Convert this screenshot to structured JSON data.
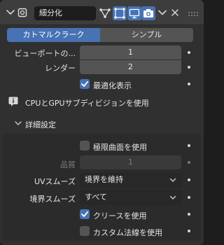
{
  "modifier": {
    "name": "細分化",
    "icons": {
      "collapse": "chevron-down-icon",
      "modifier_type": "subdivision-modifier-icon",
      "on_cage": "vertex-triangle-icon",
      "edit_mode": "edit-mode-icon",
      "realtime": "monitor-icon",
      "render": "camera-icon",
      "menu": "chevron-down-icon",
      "delete": "close-icon",
      "drag": "drag-grip-icon"
    }
  },
  "tabs": [
    {
      "label": "カトマルクラーク",
      "active": true
    },
    {
      "label": "シンプル",
      "active": false
    }
  ],
  "levels": {
    "viewport_label": "ビューポートの...",
    "viewport_value": "1",
    "render_label": "レンダー",
    "render_value": "2"
  },
  "optimal_display": {
    "label": "最適化表示",
    "checked": true
  },
  "gpu_notice": {
    "icon": "info-icon",
    "text": "CPUとGPUサブディビジョンを使用"
  },
  "advanced": {
    "title": "詳細設定",
    "limit_surface": {
      "label": "極限曲面を使用",
      "checked": false
    },
    "quality": {
      "label": "品質",
      "value": "1"
    },
    "uv_smooth": {
      "label": "UVスムーズ",
      "value": "境界を維持"
    },
    "boundary_smooth": {
      "label": "境界スムーズ",
      "value": "すべて"
    },
    "use_crease": {
      "label": "クリースを使用",
      "checked": true
    },
    "custom_normals": {
      "label": "カスタム法線を使用",
      "checked": false
    }
  },
  "colors": {
    "accent": "#4772b3",
    "panel_bg": "#303030",
    "field_bg": "#545454"
  }
}
